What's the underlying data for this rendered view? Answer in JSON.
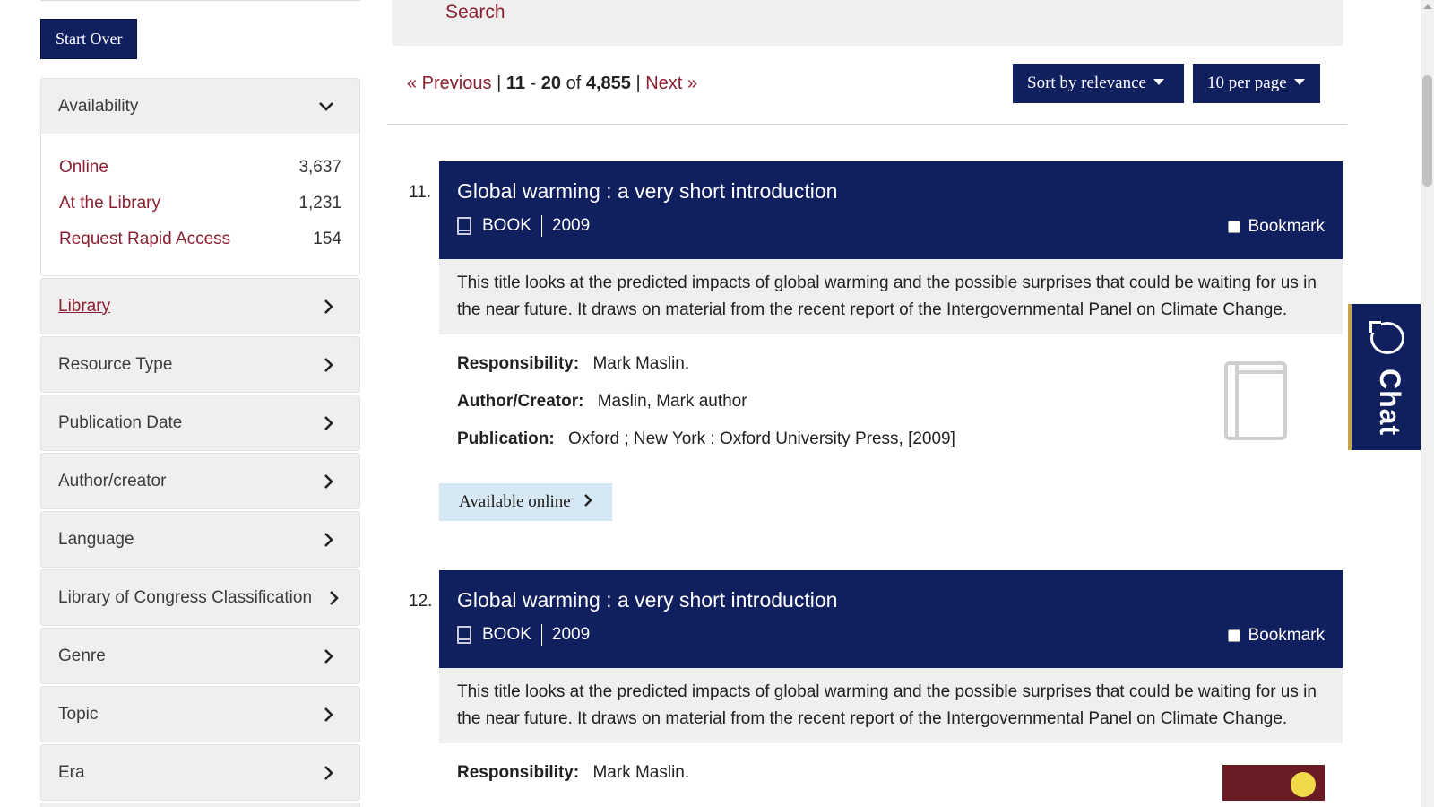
{
  "sidebar": {
    "start_over": "Start Over",
    "availability": {
      "title": "Availability",
      "values": [
        {
          "label": "Online",
          "count": "3,637"
        },
        {
          "label": "At the Library",
          "count": "1,231"
        },
        {
          "label": "Request Rapid Access",
          "count": "154"
        }
      ]
    },
    "facets": [
      "Library",
      "Resource Type",
      "Publication Date",
      "Author/creator",
      "Language",
      "Library of Congress Classification",
      "Genre",
      "Topic",
      "Era"
    ]
  },
  "search": {
    "link": "Search"
  },
  "pager": {
    "previous": "« Previous",
    "sep1": "|",
    "start": "11",
    "dash": "-",
    "end": "20",
    "of": "of",
    "total": "4,855",
    "sep2": "|",
    "next": "Next »"
  },
  "sort": {
    "label": "Sort by relevance"
  },
  "per_page": {
    "label": "10 per page"
  },
  "results": [
    {
      "number": "11.",
      "title": "Global warming : a very short introduction",
      "format": "BOOK",
      "year": "2009",
      "bookmark": "Bookmark",
      "summary": "This title looks at the predicted impacts of global warming and the possible surprises that could be waiting for us in the near future. It draws on material from the recent report of the Intergovernmental Panel on Climate Change.",
      "responsibility_label": "Responsibility:",
      "responsibility": "Mark Maslin.",
      "author_label": "Author/Creator:",
      "author": "Maslin, Mark author",
      "publication_label": "Publication:",
      "publication": "Oxford ; New York : Oxford University Press, [2009]",
      "availability": "Available online"
    },
    {
      "number": "12.",
      "title": "Global warming : a very short introduction",
      "format": "BOOK",
      "year": "2009",
      "bookmark": "Bookmark",
      "summary": "This title looks at the predicted impacts of global warming and the possible surprises that could be waiting for us in the near future. It draws on material from the recent report of the Intergovernmental Panel on Climate Change.",
      "responsibility_label": "Responsibility:",
      "responsibility": "Mark Maslin."
    }
  ],
  "chat": {
    "label": "Chat",
    "icon": "chat-bubble-icon"
  },
  "colors": {
    "navy": "#10205f",
    "maroon": "#8a1f2f",
    "gold": "#c7a44a",
    "panel": "#efefef",
    "online_button": "#d5e8f4"
  }
}
